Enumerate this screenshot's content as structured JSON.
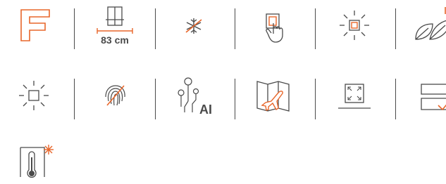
{
  "features": {
    "energy_class": {
      "name": "energy-class-f-icon",
      "letter": "F"
    },
    "width": {
      "name": "fridge-width-icon",
      "value": "83 cm"
    },
    "no_frost": {
      "name": "no-frost-icon"
    },
    "touch_control": {
      "name": "touch-control-icon"
    },
    "led_light": {
      "name": "led-light-icon"
    },
    "eco_mode": {
      "name": "eco-leaf-icon"
    },
    "interior_light": {
      "name": "interior-light-icon"
    },
    "antibacterial": {
      "name": "antibacterial-fingerprint-icon"
    },
    "ai": {
      "name": "ai-icon",
      "label": "AI"
    },
    "holiday_mode": {
      "name": "holiday-mode-icon"
    },
    "flat_design": {
      "name": "flat-door-design-icon"
    },
    "shelves": {
      "name": "shelf-check-icon"
    },
    "fast_freeze": {
      "name": "fast-freeze-thermometer-icon"
    }
  },
  "colors": {
    "accent": "#e8662a",
    "line": "#4a4a4a"
  }
}
